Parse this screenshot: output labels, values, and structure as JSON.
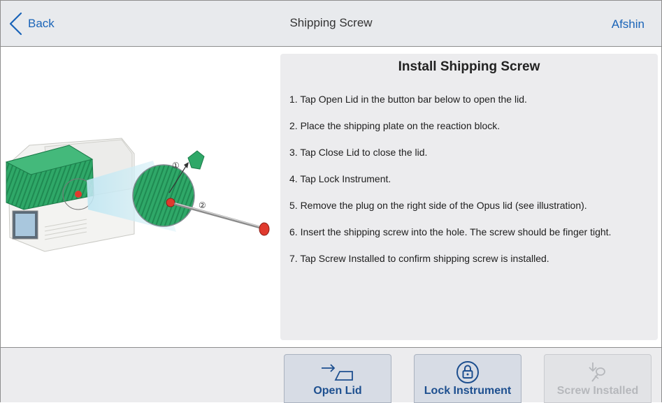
{
  "header": {
    "back_label": "Back",
    "title": "Shipping Screw",
    "user": "Afshin"
  },
  "instructions": {
    "title": "Install Shipping Screw",
    "steps": [
      "1. Tap Open Lid in the button bar below to open the lid.",
      "2. Place the shipping plate on the reaction block.",
      "3. Tap Close Lid to close the lid.",
      "4. Tap Lock Instrument.",
      "5. Remove the plug on the right side of the Opus lid (see illustration).",
      "6. Insert the shipping screw into the hole. The screw should be finger tight.",
      "7. Tap Screw Installed to confirm shipping screw is installed."
    ]
  },
  "illustration": {
    "callout_1": "①",
    "callout_2": "②"
  },
  "footer": {
    "buttons": [
      {
        "label": "Open Lid",
        "icon": "open-lid-icon",
        "enabled": true
      },
      {
        "label": "Lock Instrument",
        "icon": "lock-icon",
        "enabled": true
      },
      {
        "label": "Screw Installed",
        "icon": "screw-icon",
        "enabled": false
      }
    ]
  },
  "colors": {
    "accent": "#1a64b8",
    "button_text": "#1d4f8f",
    "instrument_green": "#2fa868",
    "plug_red": "#e03a2e"
  }
}
